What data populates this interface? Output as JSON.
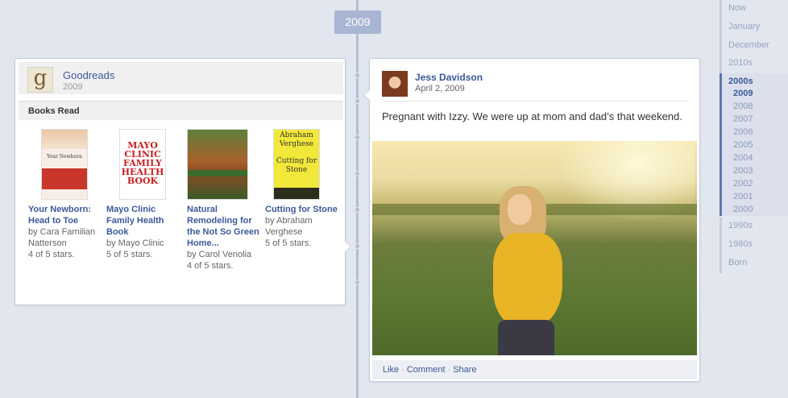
{
  "timeline": {
    "year_marker": "2009"
  },
  "goodreads": {
    "app_name": "Goodreads",
    "year": "2009",
    "logo_letter": "g",
    "section_title": "Books Read",
    "books": [
      {
        "title": "Your Newborn: Head to Toe",
        "author": "by Cara Familian Natterson",
        "rating": "4 of 5 stars.",
        "cover_text": "Your Newborn"
      },
      {
        "title": "Mayo Clinic Family Health Book",
        "author": "by Mayo Clinic",
        "rating": "5 of 5 stars.",
        "cover_text": "MAYO CLINIC FAMILY HEALTH BOOK"
      },
      {
        "title": "Natural Remodeling for the Not So Green Home...",
        "author": "by Carol Venolia",
        "rating": "4 of 5 stars.",
        "cover_text": ""
      },
      {
        "title": "Cutting for Stone",
        "author": "by Abraham Verghese",
        "rating": "5 of 5 stars.",
        "cover_author": "Abraham Verghese",
        "cover_title": "Cutting for Stone"
      }
    ]
  },
  "post": {
    "author": "Jess Davidson",
    "date": "April 2, 2009",
    "text": "Pregnant with Izzy. We were up at mom and dad’s that weekend.",
    "actions": {
      "like": "Like",
      "comment": "Comment",
      "share": "Share",
      "separator": "·"
    }
  },
  "scrubber": {
    "top_items": [
      "Now",
      "January",
      "December",
      "2010s"
    ],
    "active_label": "2000s",
    "years": [
      "2009",
      "2008",
      "2007",
      "2006",
      "2005",
      "2004",
      "2003",
      "2002",
      "2001",
      "2000"
    ],
    "selected_year": "2009",
    "bottom_items": [
      "1990s",
      "1980s",
      "Born"
    ]
  },
  "colors": {
    "link": "#3b5998",
    "timeline_bg": "#e2e6ef",
    "spine": "#b3bdd4"
  }
}
